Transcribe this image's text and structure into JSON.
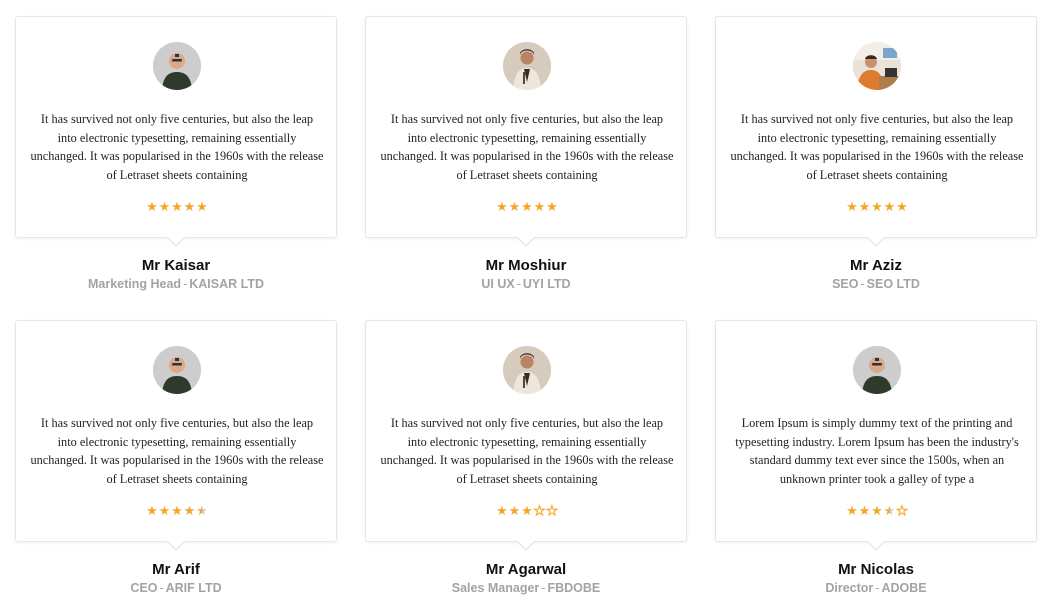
{
  "testimonials": [
    {
      "name": "Mr Kaisar",
      "title": "Marketing Head",
      "company": "KAISAR LTD",
      "quote": "It has survived not only five centuries, but also the leap into electronic typesetting, remaining essentially unchanged. It was popularised in the 1960s with the release of Letraset sheets containing",
      "rating": 5,
      "avatar": "avatar-bald-man"
    },
    {
      "name": "Mr Moshiur",
      "title": "UI UX",
      "company": "UYI LTD",
      "quote": "It has survived not only five centuries, but also the leap into electronic typesetting, remaining essentially unchanged. It was popularised in the 1960s with the release of Letraset sheets containing",
      "rating": 5,
      "avatar": "avatar-man-suit"
    },
    {
      "name": "Mr Aziz",
      "title": "SEO",
      "company": "SEO LTD",
      "quote": "It has survived not only five centuries, but also the leap into electronic typesetting, remaining essentially unchanged. It was popularised in the 1960s with the release of Letraset sheets containing",
      "rating": 5,
      "avatar": "avatar-man-desk"
    },
    {
      "name": "Mr Arif",
      "title": "CEO",
      "company": "ARIF LTD",
      "quote": "It has survived not only five centuries, but also the leap into electronic typesetting, remaining essentially unchanged. It was popularised in the 1960s with the release of Letraset sheets containing",
      "rating": 4.5,
      "avatar": "avatar-bald-man"
    },
    {
      "name": "Mr Agarwal",
      "title": "Sales Manager",
      "company": "FBDOBE",
      "quote": "It has survived not only five centuries, but also the leap into electronic typesetting, remaining essentially unchanged. It was popularised in the 1960s with the release of Letraset sheets containing",
      "rating": 3,
      "avatar": "avatar-man-suit"
    },
    {
      "name": "Mr Nicolas",
      "title": "Director",
      "company": "ADOBE",
      "quote": "Lorem Ipsum is simply dummy text of the printing and typesetting industry. Lorem Ipsum has been the industry's standard dummy text ever since the 1500s, when an unknown printer took a galley of type a",
      "rating": 3.5,
      "avatar": "avatar-bald-man"
    }
  ],
  "colors": {
    "star": "#f5a623",
    "name": "#111111",
    "role": "#a3a3a3",
    "card_border": "#e6e6e6"
  },
  "separator": "-"
}
